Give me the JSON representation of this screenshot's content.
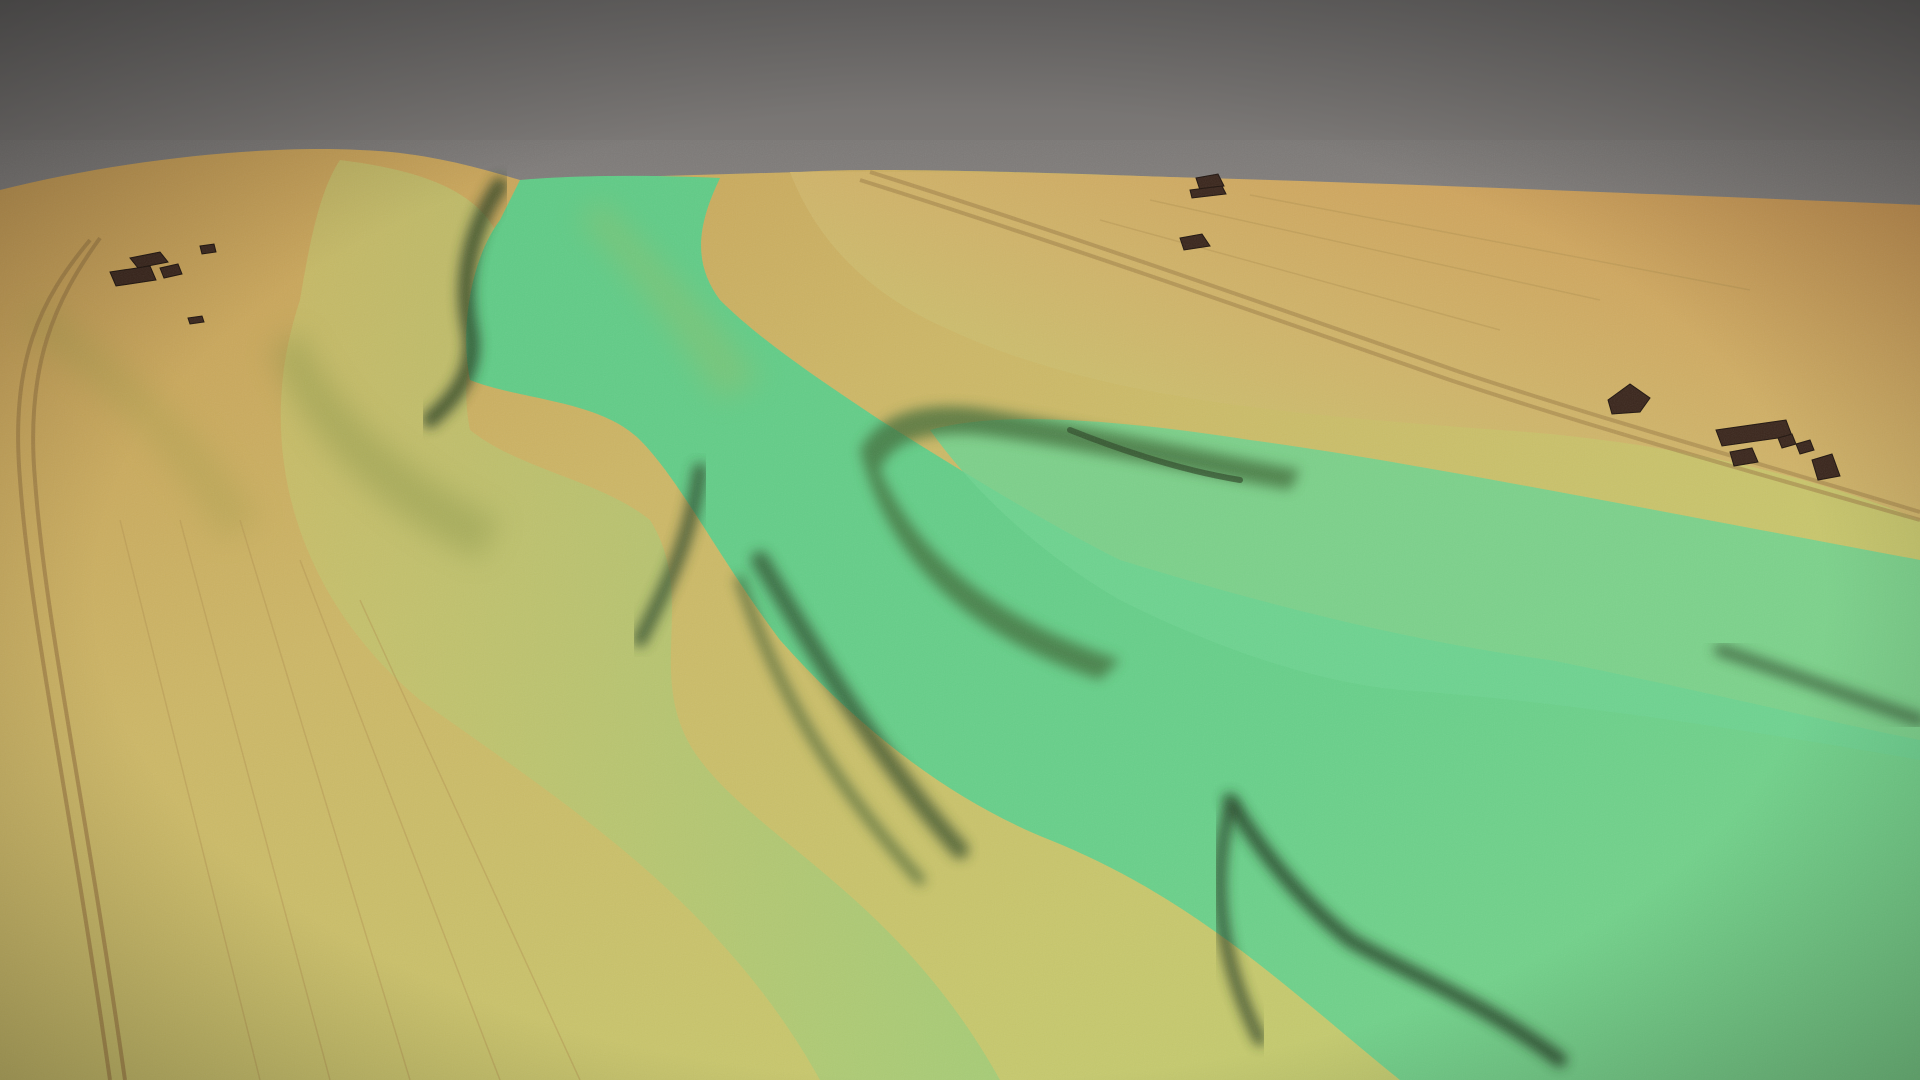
{
  "scene": {
    "kind": "shaded-relief-terrain-render",
    "colors": {
      "sky_top": "#6a6867",
      "sky_bottom": "#8a8683",
      "high_ground": "#c9a15a",
      "mid_ground": "#c9c06a",
      "slope": "#b6c76c",
      "valley_floor": "#6fd08c",
      "valley_deep": "#4fbf7a",
      "shadow": "#2f4a2a",
      "dark_object": "#3a261c"
    },
    "features": [
      {
        "name": "valley-floor",
        "icon": "valley-area"
      },
      {
        "name": "gully-channel",
        "icon": "gully-line"
      },
      {
        "name": "embankment-ridge",
        "icon": "ridge-line"
      },
      {
        "name": "building-cluster-left",
        "icon": "building-block"
      },
      {
        "name": "building-cluster-right",
        "icon": "building-block"
      },
      {
        "name": "building-cluster-top",
        "icon": "building-block"
      },
      {
        "name": "road-track-left",
        "icon": "track-line"
      },
      {
        "name": "road-track-right",
        "icon": "track-line"
      }
    ]
  }
}
